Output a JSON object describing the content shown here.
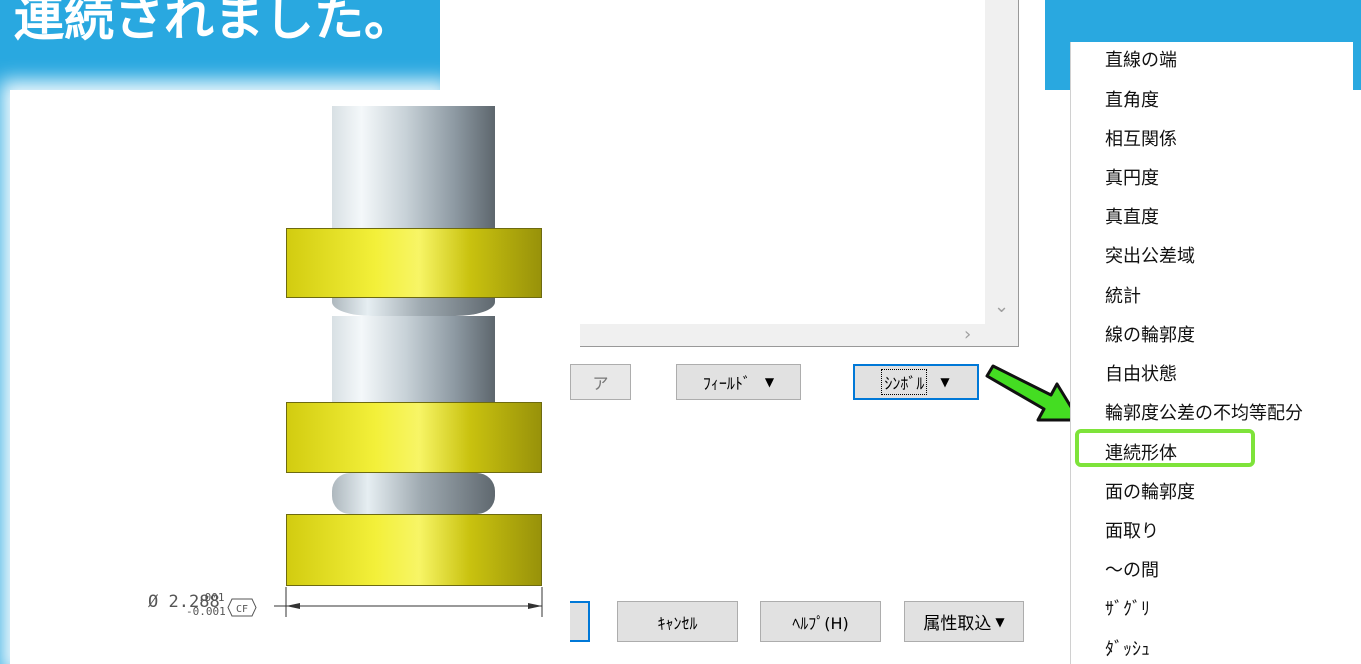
{
  "slide": {
    "title": "連続されました。"
  },
  "drawing": {
    "dimension": {
      "symbol": "Ø",
      "value": "2.288",
      "upper_tol": ".001",
      "lower_tol": "-0.001",
      "modifier": "CF"
    }
  },
  "dialog": {
    "buttons": {
      "clear": "ア",
      "field": "ﾌｨｰﾙﾄﾞ",
      "symbol": "ｼﾝﾎﾞﾙ",
      "cancel": "ｷｬﾝｾﾙ",
      "help": "ﾍﾙﾌﾟ(H)",
      "import_attributes": "属性取込"
    }
  },
  "menu": {
    "items": [
      "直線の端",
      "直角度",
      "相互関係",
      "真円度",
      "真直度",
      "突出公差域",
      "統計",
      "線の輪郭度",
      "自由状態",
      "輪郭度公差の不均等配分",
      "連続形体",
      "面の輪郭度",
      "面取り",
      "～の間",
      "ｻﾞｸﾞﾘ",
      "ﾀﾞｯｼｭ"
    ],
    "highlighted": "連続形体",
    "highlight_color": "#7ee33a",
    "pointer_color": "#44dd22"
  }
}
